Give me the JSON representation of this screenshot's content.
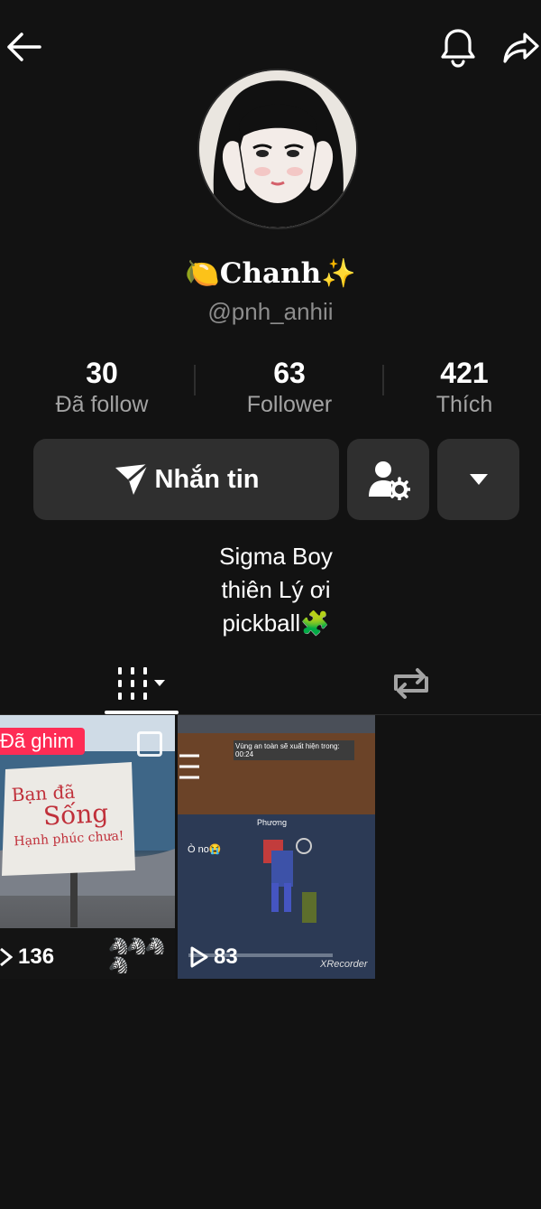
{
  "profile": {
    "display_name": "🍋Chanh✨",
    "handle": "@pnh_anhii"
  },
  "stats": [
    {
      "value": "30",
      "label": "Đã follow"
    },
    {
      "value": "63",
      "label": "Follower"
    },
    {
      "value": "421",
      "label": "Thích"
    }
  ],
  "actions": {
    "message_label": "Nhắn tin"
  },
  "bio": [
    "Sigma Boy",
    "thiên Lý ơi",
    "pickball🧩"
  ],
  "videos": [
    {
      "pinned_label": "Đã ghim",
      "views": "136",
      "sign_lines": [
        "Bạn đã",
        "Sống",
        "Hạnh phúc chưa!"
      ]
    },
    {
      "views": "83",
      "overlay_text": "Vùng an toàn sẽ xuất hiện trong: 00:24",
      "watermark": "XRecorder",
      "player_tag": "Ò no😭",
      "player_name": "Phương"
    }
  ],
  "colors": {
    "background": "#121212",
    "button": "#2f2f2f",
    "pinned": "#fe2c55",
    "muted_text": "#a3a3a3"
  }
}
